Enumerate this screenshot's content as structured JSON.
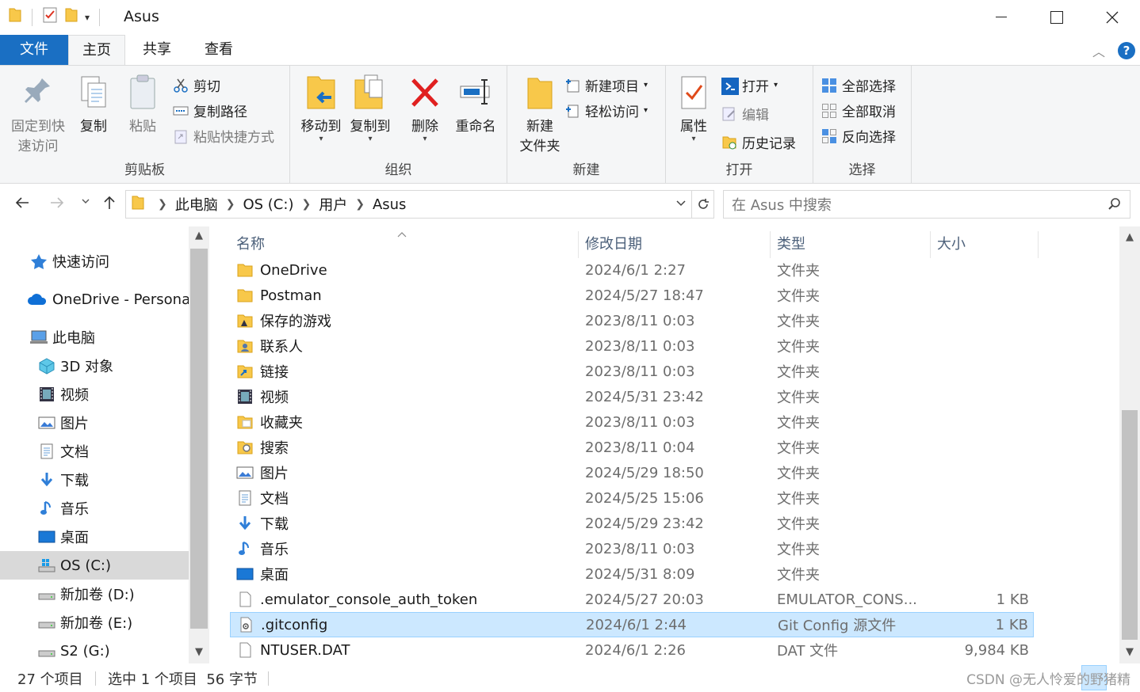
{
  "window": {
    "title": "Asus"
  },
  "ribbon_tabs": {
    "file": "文件",
    "home": "主页",
    "share": "共享",
    "view": "查看"
  },
  "ribbon": {
    "clipboard": {
      "label": "剪贴板",
      "pin": "固定到快\n速访问",
      "pin_line1": "固定到快",
      "pin_line2": "速访问",
      "copy": "复制",
      "paste": "粘贴",
      "cut": "剪切",
      "copy_path": "复制路径",
      "paste_shortcut": "粘贴快捷方式"
    },
    "organize": {
      "label": "组织",
      "move_to": "移动到",
      "copy_to": "复制到",
      "delete": "删除",
      "rename": "重命名"
    },
    "new": {
      "label": "新建",
      "new_folder_line1": "新建",
      "new_folder_line2": "文件夹",
      "new_item": "新建项目",
      "easy_access": "轻松访问"
    },
    "open": {
      "label": "打开",
      "properties": "属性",
      "open": "打开",
      "edit": "编辑",
      "history": "历史记录"
    },
    "select": {
      "label": "选择",
      "select_all": "全部选择",
      "select_none": "全部取消",
      "invert": "反向选择"
    }
  },
  "address": {
    "crumbs": [
      "此电脑",
      "OS (C:)",
      "用户",
      "Asus"
    ],
    "search_placeholder": "在 Asus 中搜索"
  },
  "nav": {
    "quick_access": "快速访问",
    "onedrive": "OneDrive - Personal",
    "this_pc": "此电脑",
    "items": [
      "3D 对象",
      "视频",
      "图片",
      "文档",
      "下载",
      "音乐",
      "桌面",
      "OS (C:)",
      "新加卷 (D:)",
      "新加卷 (E:)",
      "S2 (G:)"
    ]
  },
  "columns": {
    "name": "名称",
    "date": "修改日期",
    "type": "类型",
    "size": "大小"
  },
  "files": [
    {
      "name": "OneDrive",
      "date": "2024/6/1 2:27",
      "type": "文件夹",
      "size": "",
      "icon": "folder"
    },
    {
      "name": "Postman",
      "date": "2024/5/27 18:47",
      "type": "文件夹",
      "size": "",
      "icon": "folder"
    },
    {
      "name": "保存的游戏",
      "date": "2023/8/11 0:03",
      "type": "文件夹",
      "size": "",
      "icon": "saved-games"
    },
    {
      "name": "联系人",
      "date": "2023/8/11 0:03",
      "type": "文件夹",
      "size": "",
      "icon": "contacts"
    },
    {
      "name": "链接",
      "date": "2023/8/11 0:03",
      "type": "文件夹",
      "size": "",
      "icon": "links"
    },
    {
      "name": "视频",
      "date": "2024/5/31 23:42",
      "type": "文件夹",
      "size": "",
      "icon": "videos"
    },
    {
      "name": "收藏夹",
      "date": "2023/8/11 0:03",
      "type": "文件夹",
      "size": "",
      "icon": "favorites"
    },
    {
      "name": "搜索",
      "date": "2023/8/11 0:04",
      "type": "文件夹",
      "size": "",
      "icon": "searches"
    },
    {
      "name": "图片",
      "date": "2024/5/29 18:50",
      "type": "文件夹",
      "size": "",
      "icon": "pictures"
    },
    {
      "name": "文档",
      "date": "2024/5/25 15:06",
      "type": "文件夹",
      "size": "",
      "icon": "documents"
    },
    {
      "name": "下载",
      "date": "2024/5/29 23:42",
      "type": "文件夹",
      "size": "",
      "icon": "downloads"
    },
    {
      "name": "音乐",
      "date": "2023/8/11 0:03",
      "type": "文件夹",
      "size": "",
      "icon": "music"
    },
    {
      "name": "桌面",
      "date": "2024/5/31 8:09",
      "type": "文件夹",
      "size": "",
      "icon": "desktop"
    },
    {
      "name": ".emulator_console_auth_token",
      "date": "2024/5/27 20:03",
      "type": "EMULATOR_CONS...",
      "size": "1 KB",
      "icon": "file"
    },
    {
      "name": ".gitconfig",
      "date": "2024/6/1 2:44",
      "type": "Git Config 源文件",
      "size": "1 KB",
      "icon": "config-file",
      "selected": true
    },
    {
      "name": "NTUSER.DAT",
      "date": "2024/6/1 2:26",
      "type": "DAT 文件",
      "size": "9,984 KB",
      "icon": "file"
    }
  ],
  "status": {
    "count": "27 个项目",
    "selection": "选中 1 个项目  56 字节",
    "watermark": "CSDN @无人怜爱的野猪精"
  },
  "colors": {
    "accent": "#1a6fc3",
    "selection_bg": "#cce8ff",
    "folder": "#f8c84a"
  }
}
